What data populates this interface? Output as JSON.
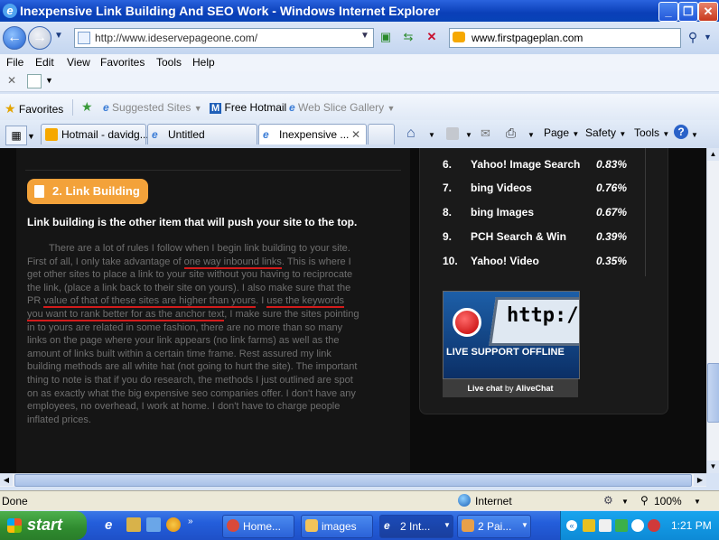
{
  "window": {
    "title": "Inexpensive Link Building And SEO Work - Windows Internet Explorer",
    "btn_min": "_",
    "btn_max": "❐",
    "btn_close": "✕"
  },
  "address": {
    "url": "http://www.ideservepageone.com/",
    "search_value": "www.firstpageplan.com"
  },
  "menu": [
    "File",
    "Edit",
    "View",
    "Favorites",
    "Tools",
    "Help"
  ],
  "favorites_bar": {
    "favorites": "Favorites",
    "suggested": "Suggested Sites",
    "hotmail": "Free Hotmail",
    "webslice": "Web Slice Gallery"
  },
  "tabs": [
    {
      "label": "Hotmail - davidg..."
    },
    {
      "label": "Untitled"
    },
    {
      "label": "Inexpensive ..."
    }
  ],
  "command_bar": {
    "page": "Page",
    "safety": "Safety",
    "tools": "Tools"
  },
  "page": {
    "heading": "2. Link Building",
    "subhead": "Link building is the other item that will push your site to the top.",
    "body_parts": [
      "There are a lot of rules I follow when I begin link building to your site. First of all, I only take advantage of ",
      "one way inbound links",
      ". This is where I get other sites to place a link to your site without you having to reciprocate the link, (place a link back to their site on yours). I also make sure that the PR ",
      "value of that of these sites are higher than yours",
      ". I ",
      "use the keywords you want to rank better for as the anchor text",
      ", I make sure the sites pointing in to yours are related in some fashion, there are no more than so many links on the page where your link appears (no link farms) as well as the amount of links built within a certain time frame. Rest assured my link building methods are all white hat (not going to hurt the site). The important thing to note is that if you do research, the methods I just outlined are spot on as exactly what the big expensive seo companies offer. I don't have any employees, no overhead, I work at home. I don't have to charge people inflated prices."
    ]
  },
  "rankings": [
    {
      "rank": "6.",
      "name": "Yahoo! Image Search",
      "pct": "0.83%"
    },
    {
      "rank": "7.",
      "name": "bing Videos",
      "pct": "0.76%"
    },
    {
      "rank": "8.",
      "name": "bing Images",
      "pct": "0.67%"
    },
    {
      "rank": "9.",
      "name": "PCH Search & Win",
      "pct": "0.39%"
    },
    {
      "rank": "10.",
      "name": "Yahoo! Video",
      "pct": "0.35%"
    }
  ],
  "live_chat": {
    "banner_url": "http://www",
    "status": "LIVE SUPPORT OFFLINE",
    "caption_a": "Live chat",
    "caption_by": "by",
    "caption_b": "AliveChat"
  },
  "statusbar": {
    "left": "Done",
    "zone": "Internet",
    "zoom": "100%"
  },
  "taskbar": {
    "start": "start",
    "items": [
      {
        "label": "Home..."
      },
      {
        "label": "images"
      },
      {
        "label": "2 Int..."
      },
      {
        "label": "2 Pai..."
      }
    ],
    "clock": "1:21 PM"
  }
}
